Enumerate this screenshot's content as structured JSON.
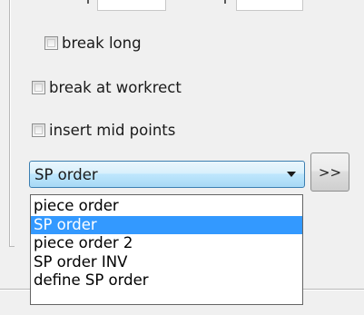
{
  "options_group": {
    "break_long": {
      "label": "break long",
      "checked": false
    },
    "break_at_workrect": {
      "label": "break at workrect",
      "checked": false
    },
    "insert_mid_points": {
      "label": "insert mid points",
      "checked": false
    }
  },
  "order_combo": {
    "selected_value": "SP order",
    "expanded": true,
    "options": [
      "piece order",
      "SP order",
      "piece order 2",
      "SP order INV",
      "define SP order"
    ],
    "highlighted_index": 1
  },
  "go_button": {
    "label": ">>"
  },
  "colors": {
    "highlight": "#3399ff",
    "combo_border": "#3c7fb1"
  }
}
